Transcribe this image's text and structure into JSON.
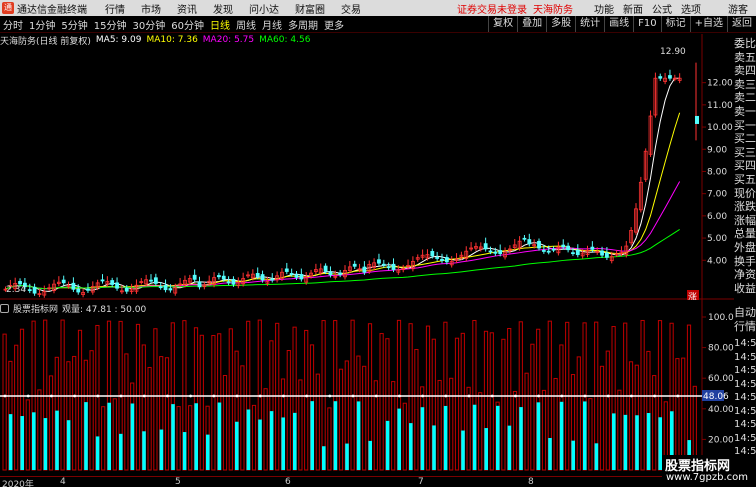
{
  "app": {
    "title": "通达信金融终端",
    "menu": [
      "行情",
      "市场",
      "资讯",
      "发现",
      "问小达",
      "财富圈",
      "交易"
    ],
    "warning": "证券交易未登录",
    "stock_name_header": "天海防务",
    "right_menu": [
      "功能",
      "新面",
      "公式",
      "选项"
    ],
    "guest": "游客"
  },
  "toolbar": {
    "periods": [
      "分时",
      "1分钟",
      "5分钟",
      "15分钟",
      "30分钟",
      "60分钟",
      "日线",
      "周线",
      "月线",
      "多周期",
      "更多"
    ],
    "active_period": "日线",
    "right_buttons": [
      "复权",
      "叠加",
      "多股",
      "统计",
      "画线",
      "F10",
      "标记",
      "+自选",
      "返回"
    ]
  },
  "main_info": {
    "stock": "天海防务(日线 前复权)",
    "ma5": "MA5: 9.09",
    "ma10": "MA10: 7.36",
    "ma20": "MA20: 5.75",
    "ma60": "MA60: 4.56"
  },
  "indicator_info": {
    "name": "股票指标网",
    "label": "观量: 47.81 : 50.00"
  },
  "price_axis": [
    "12.00",
    "11.00",
    "10.00",
    "9.00",
    "8.00",
    "7.00",
    "6.00",
    "5.00",
    "4.00"
  ],
  "price_high_label": "12.90",
  "price_low_label": "2.34",
  "indicator_axis": [
    "100.00",
    "80.00",
    "60.00",
    "40.00",
    "20.00"
  ],
  "indicator_current": "48.06",
  "date_labels": [
    "2020年",
    "4",
    "5",
    "6",
    "7",
    "8"
  ],
  "marker_label": "涨",
  "side_labels_top": [
    "委比",
    "卖五",
    "卖四",
    "卖三",
    "卖二",
    "卖一",
    "买一",
    "买二",
    "买三",
    "买四",
    "买五",
    "现价",
    "涨跌",
    "涨幅",
    "总量",
    "外盘",
    "换手",
    "净资",
    "收益"
  ],
  "side_labels_bottom": [
    "自动",
    "行情"
  ],
  "tick_times": [
    "14:5",
    "14:5",
    "14:5",
    "14:5",
    "14:5",
    "14:5",
    "14:5",
    "14:5",
    "14:5"
  ],
  "watermark": {
    "line1": "股票指标网",
    "line2": "www.7gpzb.com"
  },
  "colors": {
    "ma5": "#ffffff",
    "ma10": "#ffff00",
    "ma20": "#ff00ff",
    "ma60": "#00ff00",
    "up_candle": "#ff3232",
    "down_candle": "#54fcfc",
    "bar_red": "#c00000",
    "bar_cyan": "#00ffff"
  }
}
